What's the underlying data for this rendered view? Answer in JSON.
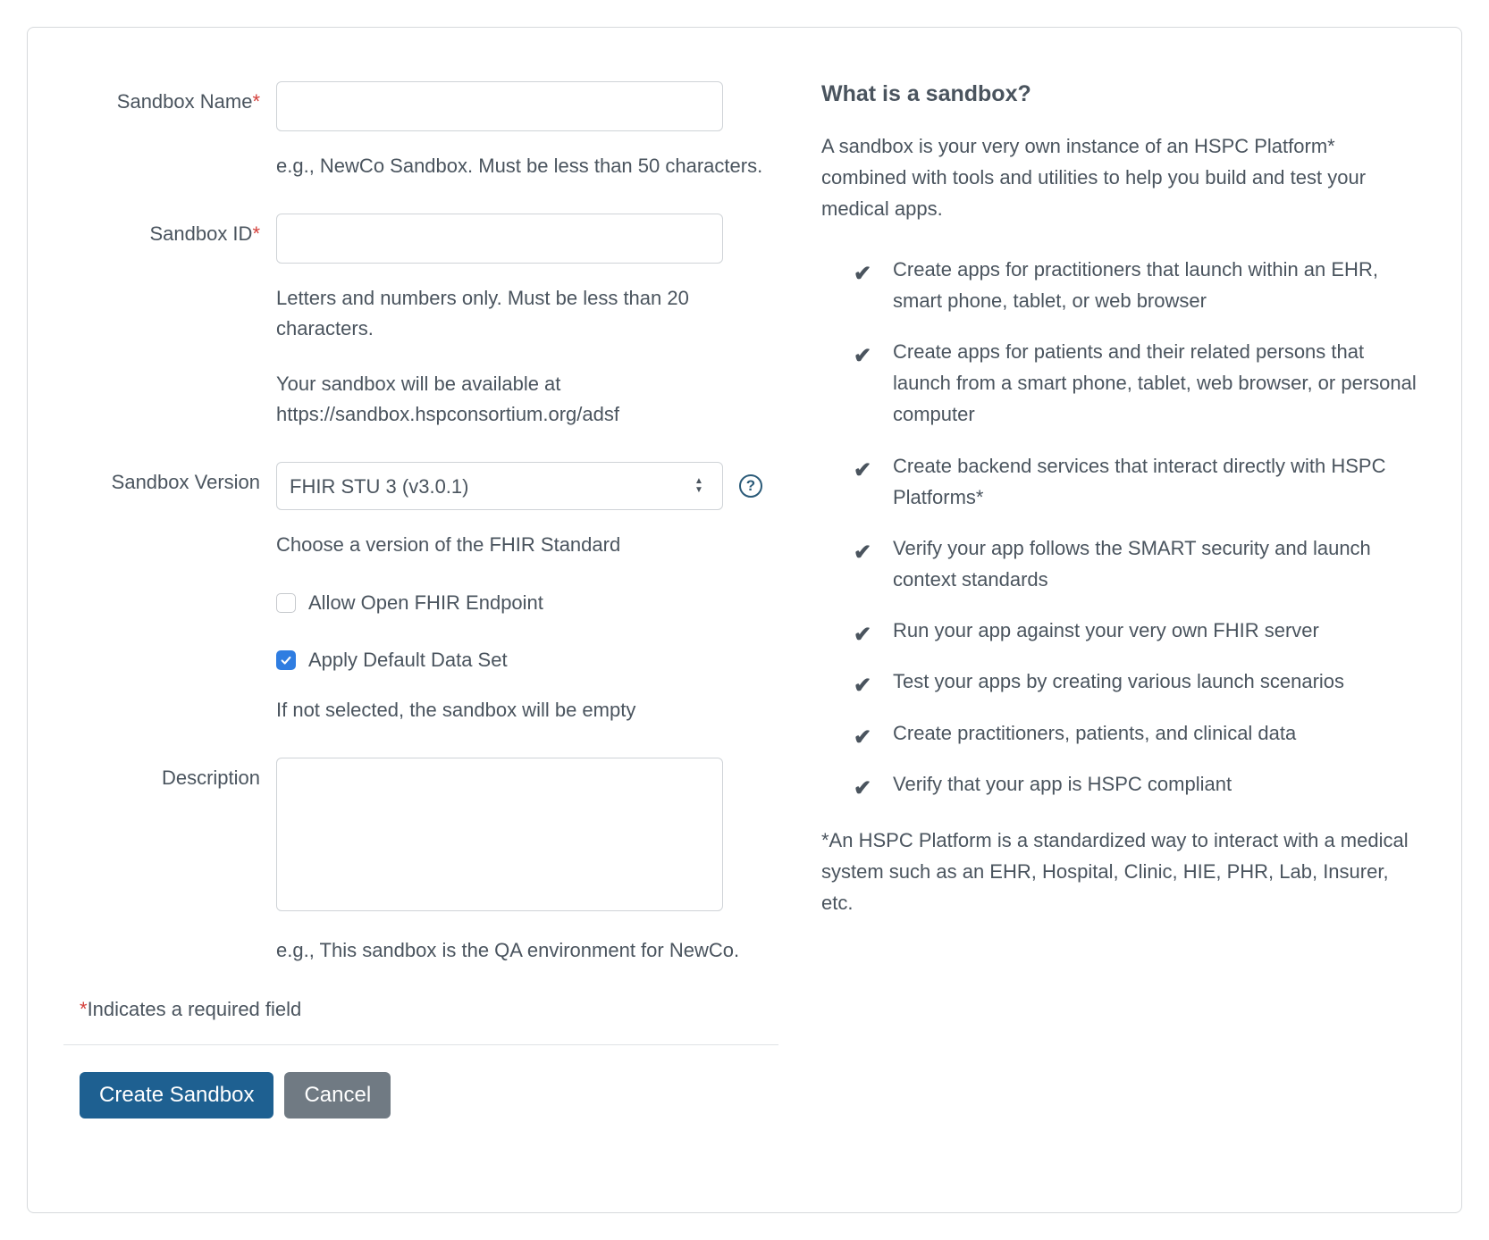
{
  "form": {
    "sandbox_name": {
      "label": "Sandbox Name",
      "required": true,
      "value": "",
      "hint": "e.g., NewCo Sandbox. Must be less than 50 characters."
    },
    "sandbox_id": {
      "label": "Sandbox ID",
      "required": true,
      "value": "",
      "hint": "Letters and numbers only. Must be less than 20 characters.",
      "url_prefix_text": "Your sandbox will be available at https://sandbox.hspconsortium.org/adsf"
    },
    "sandbox_version": {
      "label": "Sandbox Version",
      "selected": "FHIR STU 3 (v3.0.1)",
      "hint": "Choose a version of the FHIR Standard"
    },
    "allow_open_endpoint": {
      "label": "Allow Open FHIR Endpoint",
      "checked": false
    },
    "apply_default_dataset": {
      "label": "Apply Default Data Set",
      "checked": true,
      "hint": "If not selected, the sandbox will be empty"
    },
    "description": {
      "label": "Description",
      "value": "",
      "hint": "e.g., This sandbox is the QA environment for NewCo."
    },
    "required_footnote": "Indicates a required field",
    "buttons": {
      "create": "Create Sandbox",
      "cancel": "Cancel"
    }
  },
  "info": {
    "title": "What is a sandbox?",
    "intro": "A sandbox is your very own instance of an HSPC Platform* combined with tools and utilities to help you build and test your medical apps.",
    "bullets": [
      "Create apps for practitioners that launch within an EHR, smart phone, tablet, or web browser",
      "Create apps for patients and their related persons that launch from a smart phone, tablet, web browser, or personal computer",
      "Create backend services that interact directly with HSPC Platforms*",
      "Verify your app follows the SMART security and launch context standards",
      "Run your app against your very own FHIR server",
      "Test your apps by creating various launch scenarios",
      "Create practitioners, patients, and clinical data",
      "Verify that your app is HSPC compliant"
    ],
    "platform_note": "*An HSPC Platform is a standardized way to interact with a medical system such as an EHR, Hospital, Clinic, HIE, PHR, Lab, Insurer, etc."
  }
}
